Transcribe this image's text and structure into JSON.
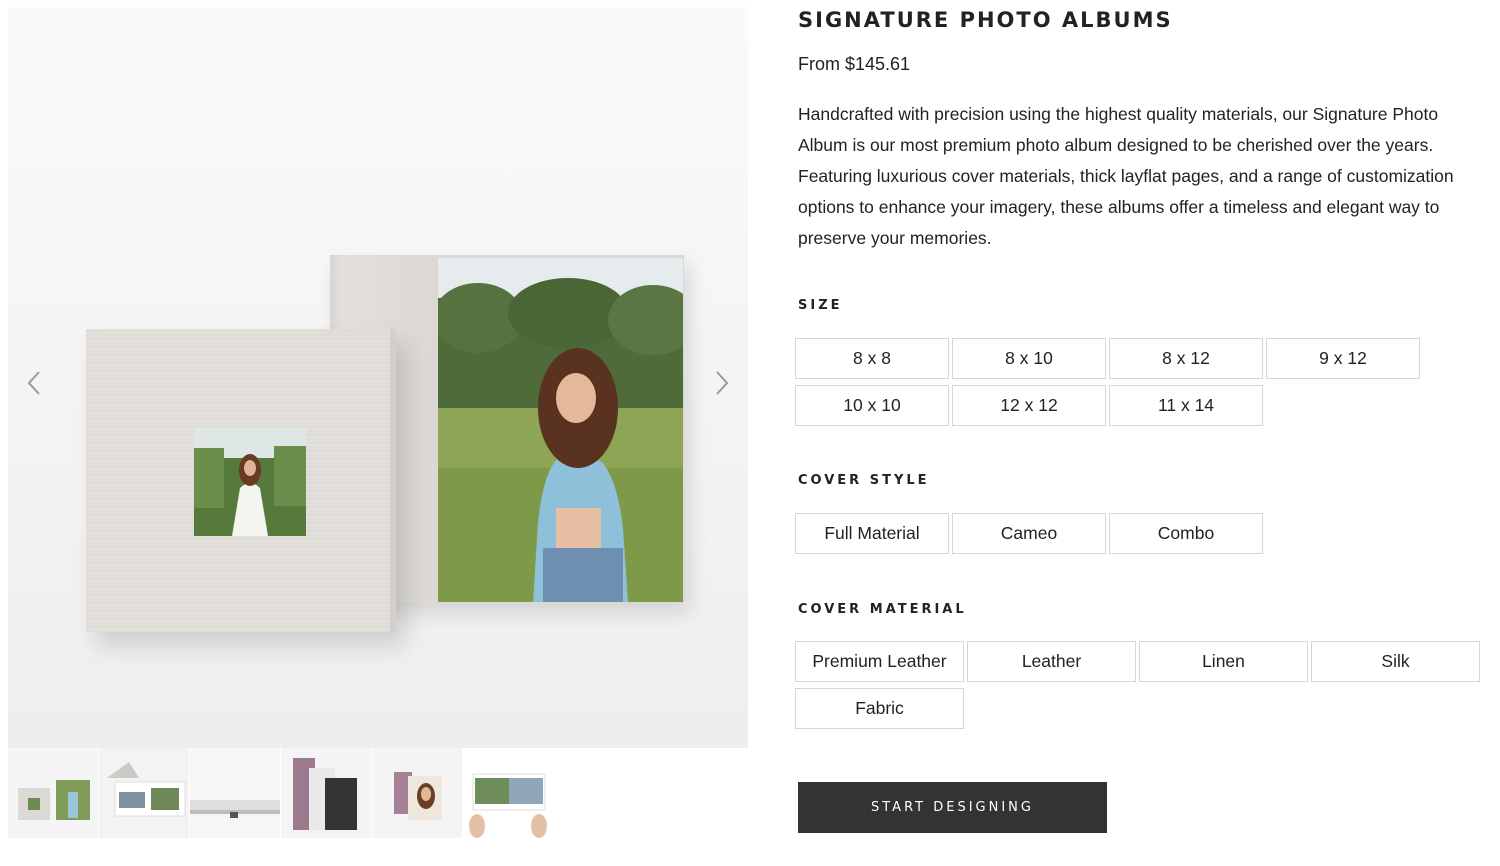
{
  "product": {
    "title": "SIGNATURE PHOTO ALBUMS",
    "price": "From $145.61",
    "description": "Handcrafted with precision using the highest quality materials, our Signature Photo Album is our most premium photo album designed to be cherished over the years. Featuring luxurious cover materials, thick layflat pages, and a range of customization options to enhance your imagery, these albums offer a timeless and elegant way to preserve your memories."
  },
  "gallery": {
    "prev_icon": "chevron-left-icon",
    "next_icon": "chevron-right-icon",
    "thumbnail_count": 6
  },
  "size": {
    "label": "SIZE",
    "options": [
      "8 x 8",
      "8 x 10",
      "8 x 12",
      "9 x 12",
      "10 x 10",
      "12 x 12",
      "11 x 14"
    ]
  },
  "cover_style": {
    "label": "COVER STYLE",
    "options": [
      "Full Material",
      "Cameo",
      "Combo"
    ]
  },
  "cover_material": {
    "label": "COVER MATERIAL",
    "options": [
      "Premium Leather",
      "Leather",
      "Linen",
      "Silk",
      "Fabric"
    ]
  },
  "cta": {
    "label": "START DESIGNING"
  },
  "colors": {
    "button_bg": "#333333",
    "option_border": "#d6d6d6",
    "text": "#222222"
  }
}
